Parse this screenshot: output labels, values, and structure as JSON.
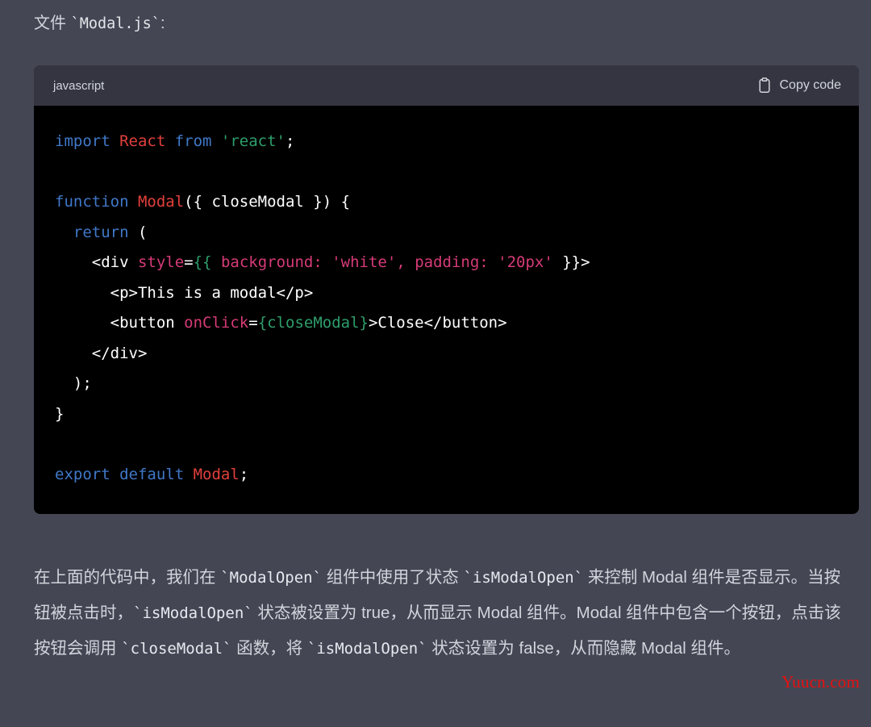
{
  "intro": {
    "prefix": "文件 ",
    "code": "`Modal.js`",
    "suffix": ":"
  },
  "code_block": {
    "language": "javascript",
    "copy_label": "Copy code",
    "copy_icon": "clipboard-icon",
    "lines": [
      {
        "segments": [
          {
            "t": "import ",
            "c": "kw"
          },
          {
            "t": "React ",
            "c": "cls"
          },
          {
            "t": "from ",
            "c": "kw"
          },
          {
            "t": "'react'",
            "c": "str"
          },
          {
            "t": ";",
            "c": "plain"
          }
        ]
      },
      {
        "segments": []
      },
      {
        "segments": [
          {
            "t": "function ",
            "c": "kw"
          },
          {
            "t": "Modal",
            "c": "cls"
          },
          {
            "t": "({ closeModal }) {",
            "c": "plain"
          }
        ]
      },
      {
        "segments": [
          {
            "t": "  ",
            "c": "plain"
          },
          {
            "t": "return",
            "c": "kw"
          },
          {
            "t": " (",
            "c": "plain"
          }
        ]
      },
      {
        "segments": [
          {
            "t": "    <div ",
            "c": "plain"
          },
          {
            "t": "style",
            "c": "attr"
          },
          {
            "t": "=",
            "c": "plain"
          },
          {
            "t": "{{",
            "c": "brc"
          },
          {
            "t": " background: ",
            "c": "attr"
          },
          {
            "t": "'white'",
            "c": "attr"
          },
          {
            "t": ", ",
            "c": "attr"
          },
          {
            "t": "padding: ",
            "c": "attr"
          },
          {
            "t": "'20px'",
            "c": "attr"
          },
          {
            "t": " }}>",
            "c": "plain"
          }
        ]
      },
      {
        "segments": [
          {
            "t": "      <p>This is a modal</p>",
            "c": "plain"
          }
        ]
      },
      {
        "segments": [
          {
            "t": "      <button ",
            "c": "plain"
          },
          {
            "t": "onClick",
            "c": "attr"
          },
          {
            "t": "=",
            "c": "plain"
          },
          {
            "t": "{closeModal}",
            "c": "brc"
          },
          {
            "t": ">Close</button>",
            "c": "plain"
          }
        ]
      },
      {
        "segments": [
          {
            "t": "    </div>",
            "c": "plain"
          }
        ]
      },
      {
        "segments": [
          {
            "t": "  );",
            "c": "plain"
          }
        ]
      },
      {
        "segments": [
          {
            "t": "}",
            "c": "plain"
          }
        ]
      },
      {
        "segments": []
      },
      {
        "segments": [
          {
            "t": "export ",
            "c": "kw"
          },
          {
            "t": "default ",
            "c": "kw"
          },
          {
            "t": "Modal",
            "c": "cls"
          },
          {
            "t": ";",
            "c": "plain"
          }
        ]
      }
    ]
  },
  "paragraph": {
    "parts": [
      {
        "t": "在上面的代码中，我们在 ",
        "mono": false
      },
      {
        "t": "`ModalOpen`",
        "mono": true
      },
      {
        "t": " 组件中使用了状态 ",
        "mono": false
      },
      {
        "t": "`isModalOpen`",
        "mono": true
      },
      {
        "t": " 来控制 Modal 组件是否显示。当按钮被点击时，",
        "mono": false
      },
      {
        "t": "`isModalOpen`",
        "mono": true
      },
      {
        "t": " 状态被设置为 true，从而显示 Modal 组件。Modal 组件中包含一个按钮，点击该按钮会调用 ",
        "mono": false
      },
      {
        "t": "`closeModal`",
        "mono": true
      },
      {
        "t": " 函数，将 ",
        "mono": false
      },
      {
        "t": "`isModalOpen`",
        "mono": true
      },
      {
        "t": " 状态设置为 false，从而隐藏 Modal 组件。",
        "mono": false
      }
    ]
  },
  "watermark": {
    "text": "Yuucn.com"
  },
  "colors": {
    "page_background": "#444654",
    "code_header_background": "#343541",
    "code_background": "#000000",
    "body_text": "#d1d5db",
    "keyword": "#4078c8",
    "class_name": "#e1403c",
    "string": "#2e9e6b",
    "attribute": "#d63b77",
    "brace": "#2e9e6b",
    "watermark": "#e81010"
  }
}
